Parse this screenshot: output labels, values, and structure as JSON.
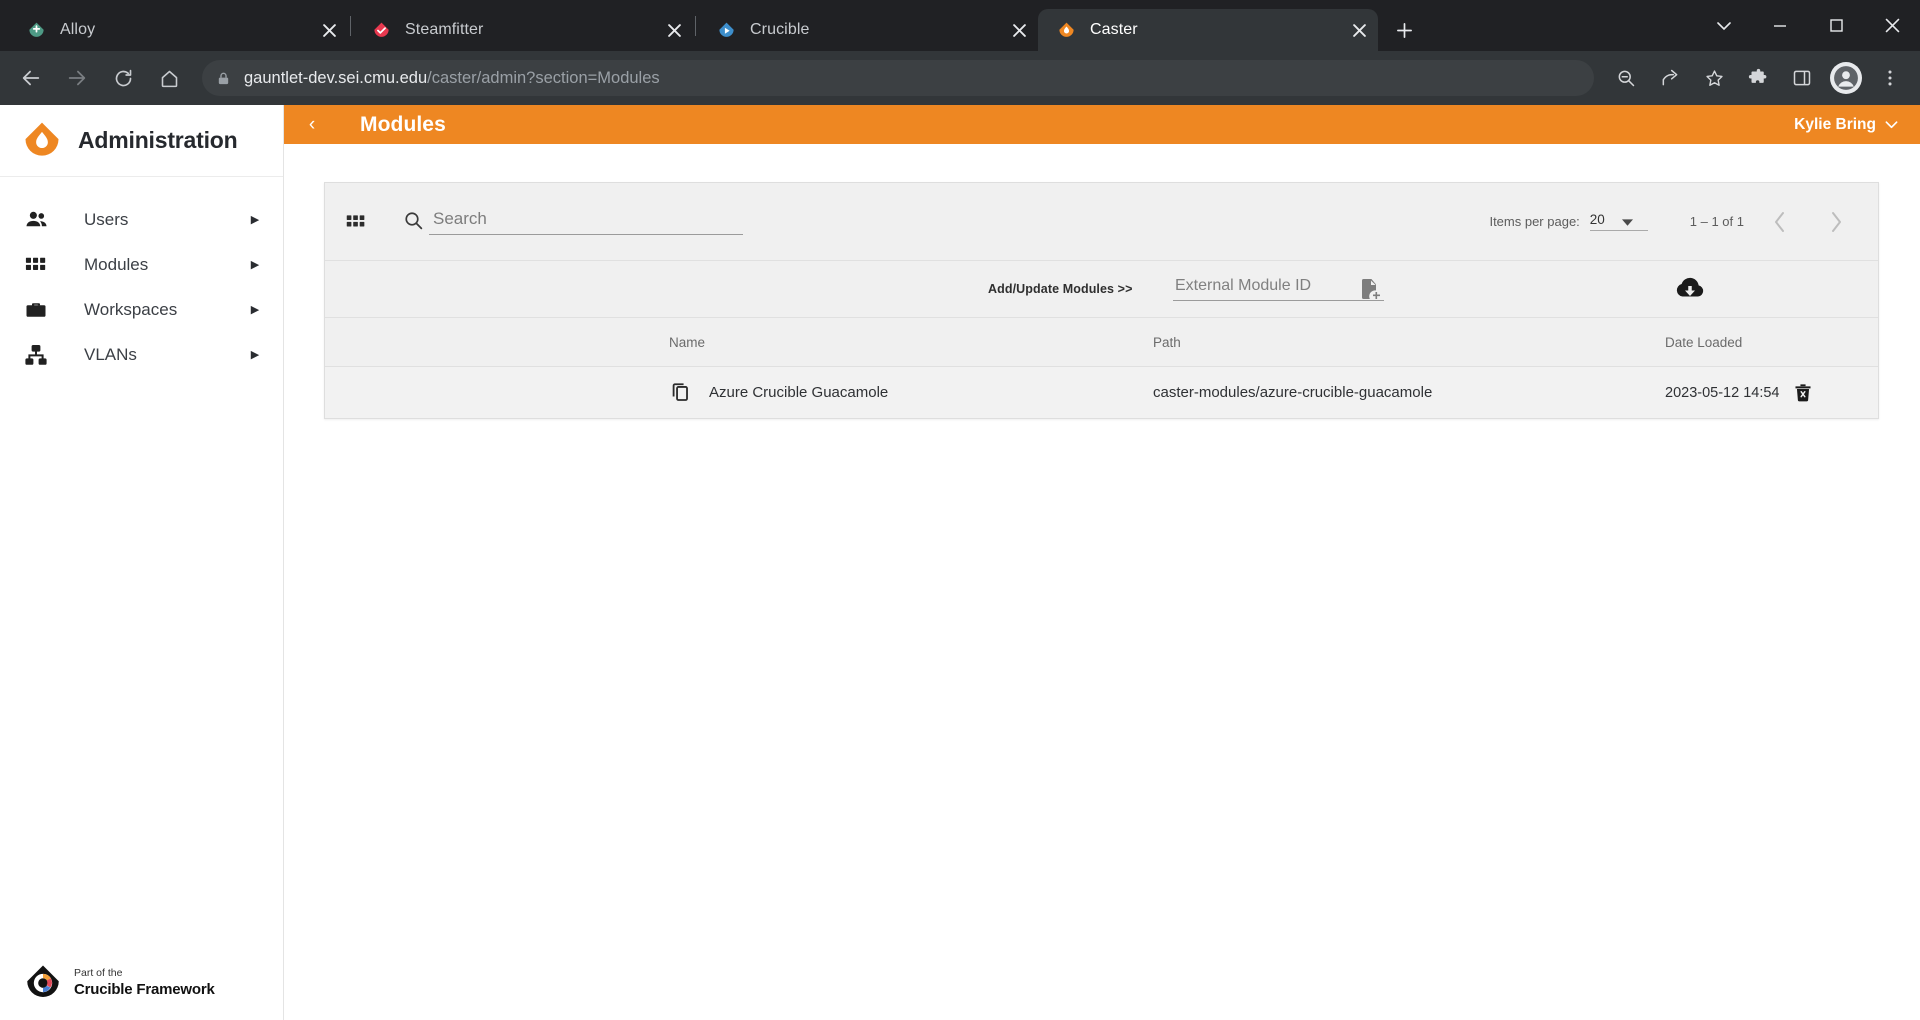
{
  "browser": {
    "tabs": [
      {
        "title": "Alloy",
        "favicon": "alloy-droplet-icon",
        "favicon_color": "#4e9a85",
        "active": false
      },
      {
        "title": "Steamfitter",
        "favicon": "steamfitter-check-icon",
        "favicon_color": "#e8384f",
        "active": false
      },
      {
        "title": "Crucible",
        "favicon": "crucible-play-icon",
        "favicon_color": "#3d8ecb",
        "active": false
      },
      {
        "title": "Caster",
        "favicon": "caster-droplet-icon",
        "favicon_color": "#ee8722",
        "active": true
      }
    ],
    "new_tab_label": "+",
    "window_controls": {
      "minimize": "—",
      "maximize": "□",
      "close": "✕",
      "tab_search": "⌄"
    },
    "nav": {
      "back": "←",
      "forward": "→",
      "reload": "↻",
      "home": "⌂"
    },
    "omnibox": {
      "lock_icon": "lock-icon",
      "domain": "gauntlet-dev.sei.cmu.edu",
      "path": "/caster/admin?section=Modules"
    },
    "toolbar_icons": [
      "zoom-out-icon",
      "share-icon",
      "bookmark-star-icon",
      "extensions-puzzle-icon",
      "side-panel-icon",
      "profile-avatar-icon",
      "kebab-menu-icon"
    ]
  },
  "sidebar": {
    "brand": {
      "logo": "caster-droplet-logo",
      "title": "Administration"
    },
    "items": [
      {
        "label": "Users",
        "icon": "people-icon",
        "arrow": "▶"
      },
      {
        "label": "Modules",
        "icon": "grid-apps-icon",
        "arrow": "▶"
      },
      {
        "label": "Workspaces",
        "icon": "briefcase-icon",
        "arrow": "▶"
      },
      {
        "label": "VLANs",
        "icon": "device-hub-icon",
        "arrow": "▶"
      }
    ],
    "footer": {
      "logo": "crucible-framework-logo",
      "line1": "Part of the",
      "line2": "Crucible Framework"
    }
  },
  "topbar": {
    "back_chevron": "‹",
    "title": "Modules",
    "user_name": "Kylie Bring",
    "user_caret": "chevron-down-icon",
    "background": "#ee8722"
  },
  "toolbar": {
    "grid_icon": "grid-view-icon",
    "search_icon": "search-icon",
    "search_value": "",
    "search_placeholder": "Search",
    "items_per_page_label": "Items per page:",
    "items_per_page_value": "20",
    "items_per_page_options": [
      "20"
    ],
    "range_label": "1 – 1 of 1",
    "prev_label": "‹",
    "next_label": "›"
  },
  "add_row": {
    "label": "Add/Update Modules >>",
    "external_id_value": "",
    "external_id_placeholder": "External Module ID",
    "note_add_icon": "note-add-icon",
    "cloud_download_icon": "cloud-download-icon"
  },
  "table": {
    "columns": [
      "Name",
      "Path",
      "Date Loaded"
    ],
    "rows": [
      {
        "copy_icon": "copy-icon",
        "name": "Azure Crucible Guacamole",
        "path": "caster-modules/azure-crucible-guacamole",
        "date_loaded": "2023-05-12 14:54",
        "delete_icon": "delete-forever-icon"
      }
    ]
  }
}
